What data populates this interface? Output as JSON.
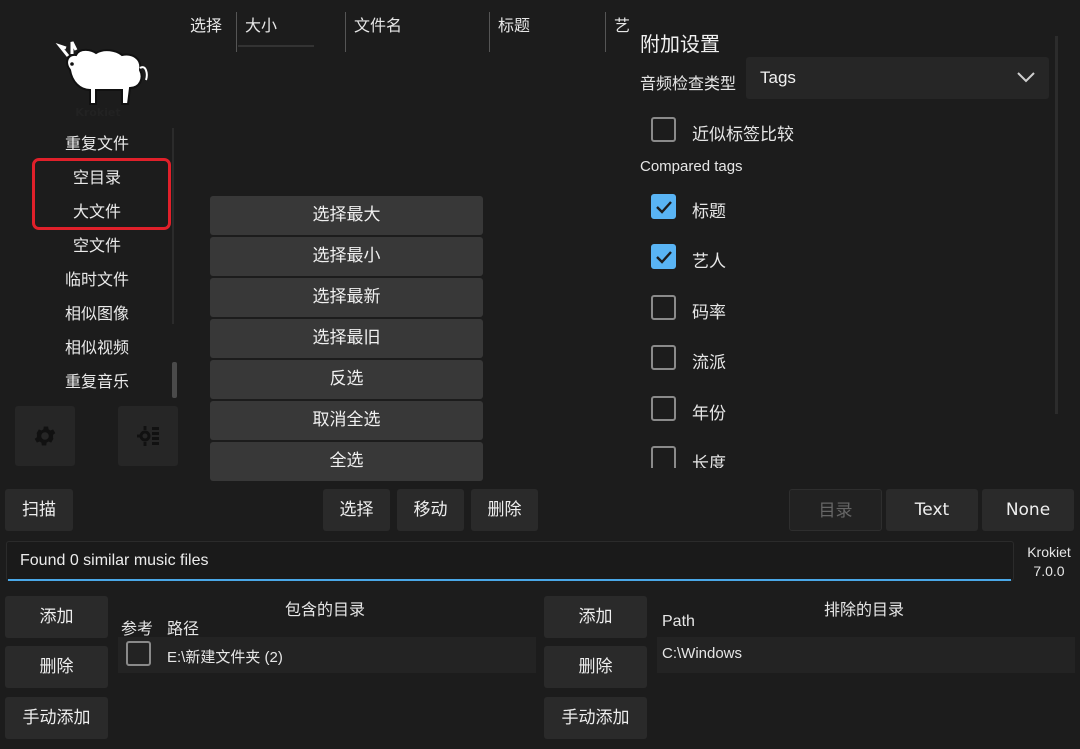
{
  "app": {
    "logo_text": "Krokiet",
    "name": "Krokiet",
    "version": "7.0.0"
  },
  "sidebar": {
    "items": [
      {
        "label": "重复文件"
      },
      {
        "label": "空目录"
      },
      {
        "label": "大文件"
      },
      {
        "label": "空文件"
      },
      {
        "label": "临时文件"
      },
      {
        "label": "相似图像"
      },
      {
        "label": "相似视频"
      },
      {
        "label": "重复音乐"
      }
    ],
    "settings_icon": "gear-icon",
    "tools_icon": "gear-panel-icon"
  },
  "results": {
    "columns": [
      "选择",
      "大小",
      "文件名",
      "标题",
      "艺"
    ]
  },
  "select_menu": {
    "items": [
      "选择最大",
      "选择最小",
      "选择最新",
      "选择最旧",
      "反选",
      "取消全选",
      "全选"
    ]
  },
  "settings": {
    "title": "附加设置",
    "audio_check_label": "音频检查类型",
    "audio_check_value": "Tags",
    "approximate_tags": {
      "label": "近似标签比较",
      "checked": false
    },
    "compared_tags_label": "Compared tags",
    "tags": [
      {
        "label": "标题",
        "checked": true
      },
      {
        "label": "艺人",
        "checked": true
      },
      {
        "label": "码率",
        "checked": false
      },
      {
        "label": "流派",
        "checked": false
      },
      {
        "label": "年份",
        "checked": false
      },
      {
        "label": "长度",
        "checked": false
      }
    ]
  },
  "actions": {
    "scan": "扫描",
    "select": "选择",
    "move": "移动",
    "delete": "删除",
    "directory": "目录",
    "text": "Text",
    "none": "None"
  },
  "status": {
    "message": "Found 0 similar music files"
  },
  "included": {
    "title": "包含的目录",
    "add": "添加",
    "remove": "删除",
    "manual_add": "手动添加",
    "col_ref": "参考",
    "col_path": "路径",
    "rows": [
      {
        "path": "E:\\新建文件夹 (2)",
        "reference": false
      }
    ]
  },
  "excluded": {
    "title": "排除的目录",
    "add": "添加",
    "remove": "删除",
    "manual_add": "手动添加",
    "col_path": "Path",
    "rows": [
      {
        "path": "C:\\Windows"
      }
    ]
  },
  "colors": {
    "accent": "#59b4f4",
    "highlight_box": "#e0202a",
    "background": "#1c1c1c"
  }
}
